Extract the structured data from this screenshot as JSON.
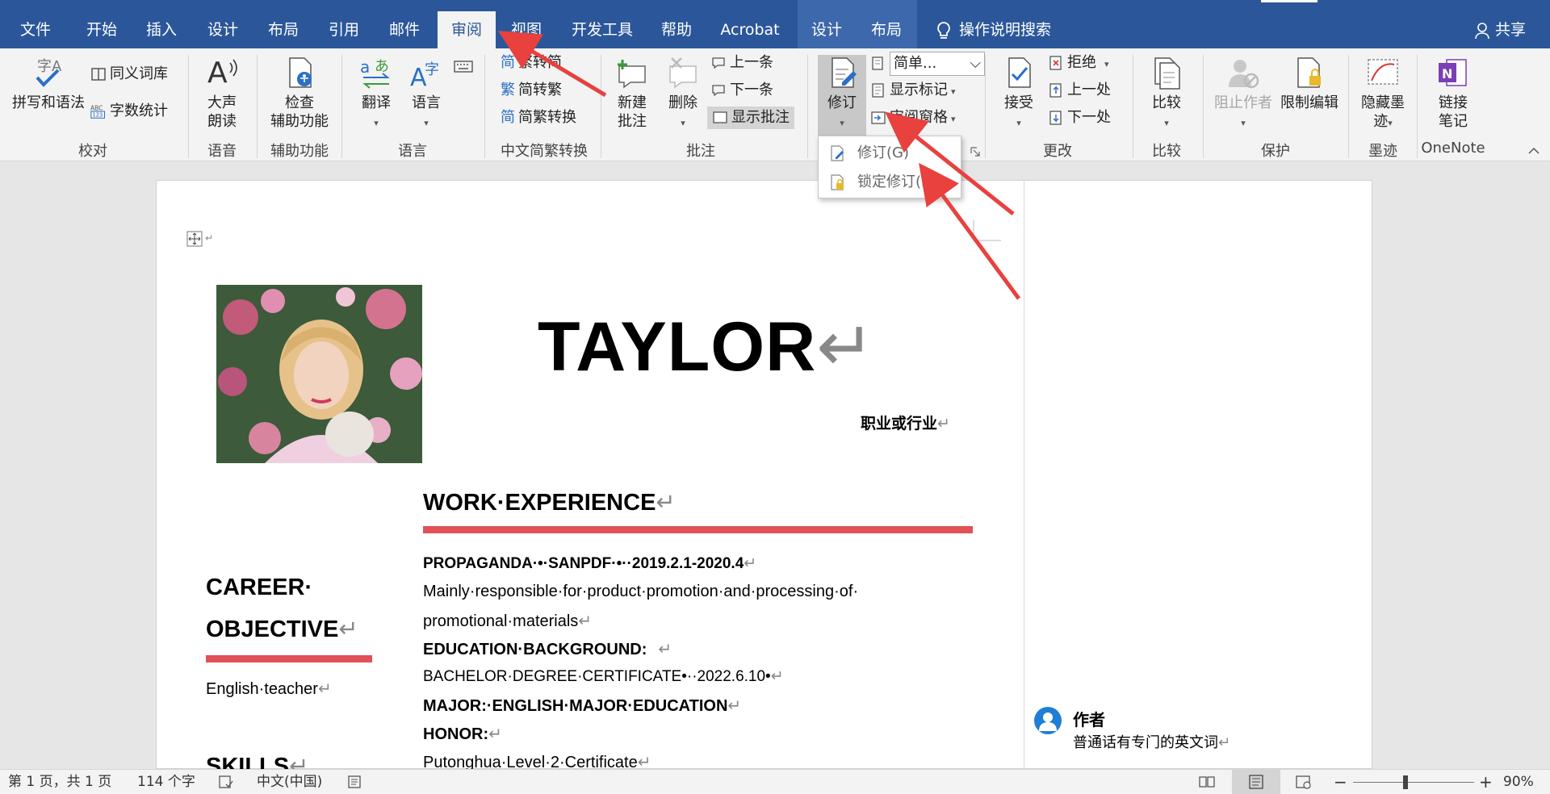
{
  "tabs": [
    {
      "label": "文件",
      "active": false
    },
    {
      "label": "开始",
      "active": false
    },
    {
      "label": "插入",
      "active": false
    },
    {
      "label": "设计",
      "active": false
    },
    {
      "label": "布局",
      "active": false
    },
    {
      "label": "引用",
      "active": false
    },
    {
      "label": "邮件",
      "active": false
    },
    {
      "label": "审阅",
      "active": true
    },
    {
      "label": "视图",
      "active": false
    },
    {
      "label": "开发工具",
      "active": false
    },
    {
      "label": "帮助",
      "active": false
    },
    {
      "label": "Acrobat",
      "active": false
    },
    {
      "label": "设计",
      "active": false
    },
    {
      "label": "布局",
      "active": false
    }
  ],
  "tell_me": "操作说明搜索",
  "share": "共享",
  "ribbon": {
    "proofing": {
      "spell": "拼写和语法",
      "thesaurus": "同义词库",
      "word_count": "字数统计",
      "label": "校对"
    },
    "speech": {
      "read_aloud_1": "大声",
      "read_aloud_2": "朗读",
      "label": "语音"
    },
    "accessibility": {
      "check_1": "检查",
      "check_2": "辅助功能",
      "label": "辅助功能"
    },
    "language": {
      "translate": "翻译",
      "language": "语言",
      "label": "语言"
    },
    "chinese": {
      "t2s": "繁转简",
      "s2t": "简转繁",
      "convert": "简繁转换",
      "label": "中文简繁转换"
    },
    "comments": {
      "new_1": "新建",
      "new_2": "批注",
      "delete": "删除",
      "prev": "上一条",
      "next": "下一条",
      "show": "显示批注",
      "label": "批注"
    },
    "tracking": {
      "track": "修订",
      "display": "简单...",
      "show_markup": "显示标记",
      "pane": "审阅窗格"
    },
    "changes": {
      "accept": "接受",
      "reject": "拒绝",
      "prev": "上一处",
      "next": "下一处",
      "label": "更改"
    },
    "compare": {
      "compare": "比较",
      "label": "比较"
    },
    "protect": {
      "block": "阻止作者",
      "restrict": "限制编辑",
      "label": "保护"
    },
    "ink": {
      "hide_1": "隐藏墨",
      "hide_2": "迹",
      "label": "墨迹"
    },
    "onenote": {
      "link_1": "链接",
      "link_2": "笔记",
      "label": "OneNote"
    }
  },
  "menu": {
    "track": "修订(G)",
    "lock": "锁定修订(L)"
  },
  "document": {
    "name": "TAYLOR",
    "profession": "职业或行业",
    "work_heading": "WORK·EXPERIENCE",
    "job_line": "PROPAGANDA·•·SANPDF·•··2019.2.1-2020.4",
    "job_desc_1": "Mainly·responsible·for·product·promotion·and·processing·of·",
    "job_desc_2": "promotional·materials",
    "edu_heading": "EDUCATION·BACKGROUND:",
    "edu_line": "BACHELOR·DEGREE·CERTIFICATE•··2022.6.10•",
    "major": "MAJOR:·ENGLISH·MAJOR·EDUCATION",
    "honor": "HONOR:",
    "honor_line": "Putonghua·Level·2·Certificate",
    "career_1": "CAREER·",
    "career_2": "OBJECTIVE",
    "career_text": "English·teacher",
    "skills": "SKILLS"
  },
  "comment": {
    "author": "作者",
    "text": "普通话有专门的英文词"
  },
  "status": {
    "page": "第 1 页，共 1 页",
    "words": "114 个字",
    "lang": "中文(中国)",
    "zoom": "90%"
  },
  "colors": {
    "accent": "#2b579a",
    "redbar": "#e05257",
    "arrow": "#e8413e"
  }
}
